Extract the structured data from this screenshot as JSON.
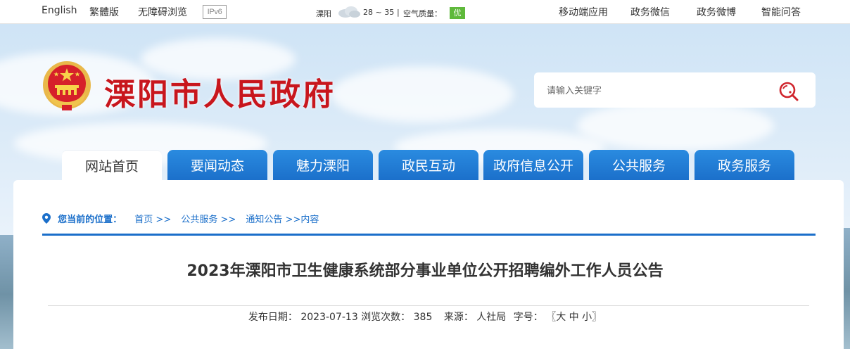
{
  "topbar": {
    "links_left": [
      "English",
      "繁體版",
      "无障碍浏览"
    ],
    "ipv6": "IPv6",
    "weather": {
      "city": "溧阳",
      "temp": "28 ~ 35",
      "sep": "|",
      "aq_label": "空气质量：",
      "aq_value": "优",
      "aq_color": "#5fb93b"
    },
    "links_right": [
      "移动端应用",
      "政务微信",
      "政务微博",
      "智能问答"
    ]
  },
  "header": {
    "title": "溧阳市人民政府",
    "title_color": "#c8161d",
    "search": {
      "placeholder": "请输入关键字",
      "icon": "search-icon"
    }
  },
  "nav": {
    "tabs": [
      "网站首页",
      "要闻动态",
      "魅力溧阳",
      "政民互动",
      "政府信息公开",
      "公共服务",
      "政务服务"
    ],
    "active_index": 0,
    "accent": "#1b6fca"
  },
  "breadcrumb": {
    "label": "您当前的位置：",
    "items": [
      "首页 >>",
      "公共服务 >>",
      "通知公告 >>",
      "内容"
    ]
  },
  "article": {
    "title": "2023年溧阳市卫生健康系统部分事业单位公开招聘编外工作人员公告",
    "date_label": "发布日期：",
    "date": "2023-07-13",
    "views_label": "浏览次数：",
    "views": "385",
    "source_label": "来源：",
    "source": "人社局",
    "size_label": "字号：",
    "size_open": "〖",
    "size_large": "大",
    "size_medium": "中",
    "size_small": "小",
    "size_close": "〗"
  }
}
